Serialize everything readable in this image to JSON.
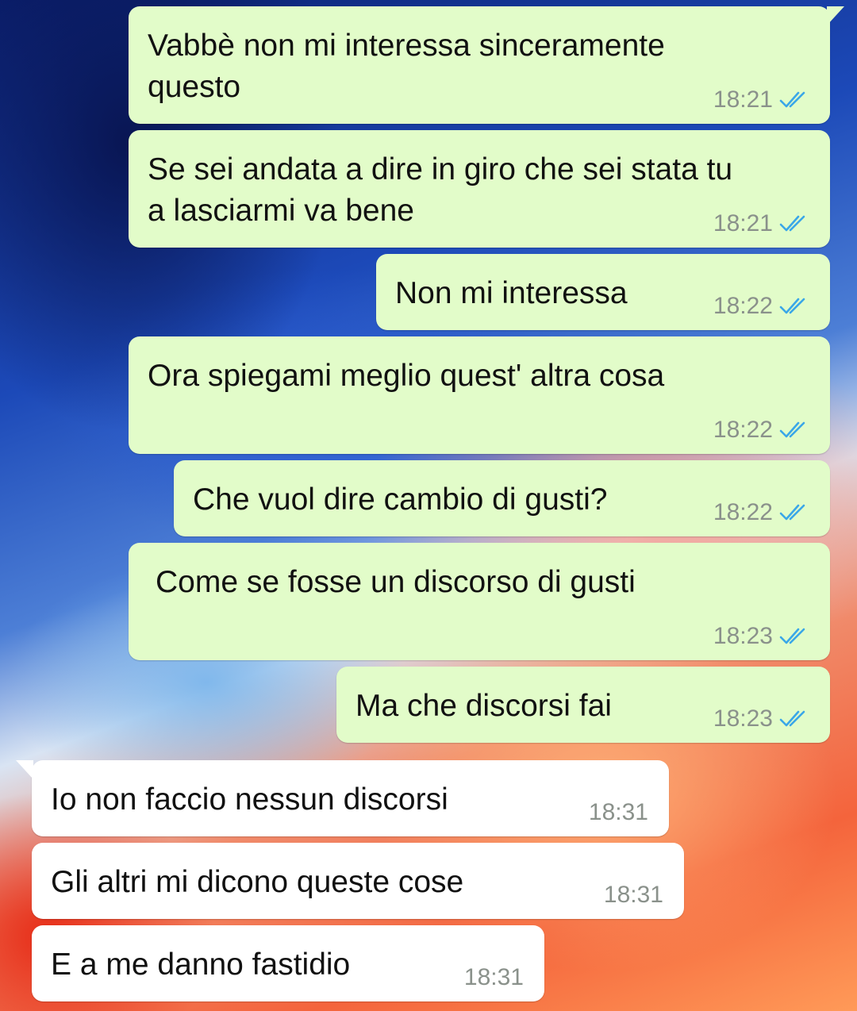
{
  "conversation": {
    "messages": [
      {
        "direction": "outgoing",
        "text": "Vabbè non mi interessa sinceramente\nquesto",
        "time": "18:21",
        "status": "read-double-check-icon"
      },
      {
        "direction": "outgoing",
        "text": "Se sei andata a dire in giro che sei stata tu\na lasciarmi va bene",
        "time": "18:21",
        "status": "read-double-check-icon"
      },
      {
        "direction": "outgoing",
        "text": "Non mi interessa",
        "time": "18:22",
        "status": "read-double-check-icon"
      },
      {
        "direction": "outgoing",
        "text": "Ora spiegami meglio quest' altra cosa",
        "time": "18:22",
        "status": "read-double-check-icon"
      },
      {
        "direction": "outgoing",
        "text": "Che vuol dire cambio di gusti?",
        "time": "18:22",
        "status": "read-double-check-icon"
      },
      {
        "direction": "outgoing",
        "text": "Come se fosse un discorso di gusti",
        "time": "18:23",
        "status": "read-double-check-icon"
      },
      {
        "direction": "outgoing",
        "text": "Ma che discorsi fai",
        "time": "18:23",
        "status": "read-double-check-icon"
      },
      {
        "direction": "incoming",
        "text": "Io non faccio nessun discorsi",
        "time": "18:31"
      },
      {
        "direction": "incoming",
        "text": "Gli altri mi dicono queste cose",
        "time": "18:31"
      },
      {
        "direction": "incoming",
        "text": "E a me danno fastidio",
        "time": "18:31"
      }
    ]
  },
  "colors": {
    "outgoing_bubble": "#e2fcc9",
    "incoming_bubble": "#ffffff",
    "read_ticks": "#3aa7e8",
    "time_text": "#8a918b"
  }
}
